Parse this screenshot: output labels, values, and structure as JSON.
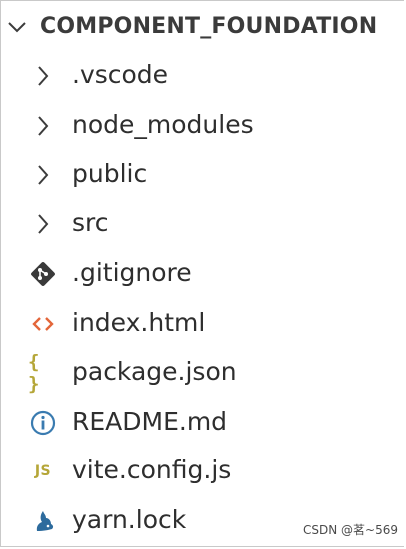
{
  "explorer": {
    "root_label": "COMPONENT_FOUNDATION",
    "items": [
      {
        "label": ".vscode",
        "kind": "folder",
        "icon": "chevron-right-icon"
      },
      {
        "label": "node_modules",
        "kind": "folder",
        "icon": "chevron-right-icon"
      },
      {
        "label": "public",
        "kind": "folder",
        "icon": "chevron-right-icon"
      },
      {
        "label": "src",
        "kind": "folder",
        "icon": "chevron-right-icon"
      },
      {
        "label": ".gitignore",
        "kind": "file",
        "icon": "git-icon"
      },
      {
        "label": "index.html",
        "kind": "file",
        "icon": "html-icon"
      },
      {
        "label": "package.json",
        "kind": "file",
        "icon": "json-icon",
        "icon_text": "{ }"
      },
      {
        "label": "README.md",
        "kind": "file",
        "icon": "info-icon"
      },
      {
        "label": "vite.config.js",
        "kind": "file",
        "icon": "javascript-icon",
        "icon_text": "JS"
      },
      {
        "label": "yarn.lock",
        "kind": "file",
        "icon": "yarn-icon"
      }
    ]
  },
  "watermark": "CSDN @茗~569",
  "colors": {
    "text": "#2e2e2e",
    "header_text": "#3b3b3b",
    "chevron": "#3c3c3c",
    "git": "#3a3a3a",
    "html": "#e3663a",
    "json": "#b5a638",
    "info": "#3a7bb0",
    "javascript": "#b5a638",
    "yarn": "#2d6b9d"
  }
}
